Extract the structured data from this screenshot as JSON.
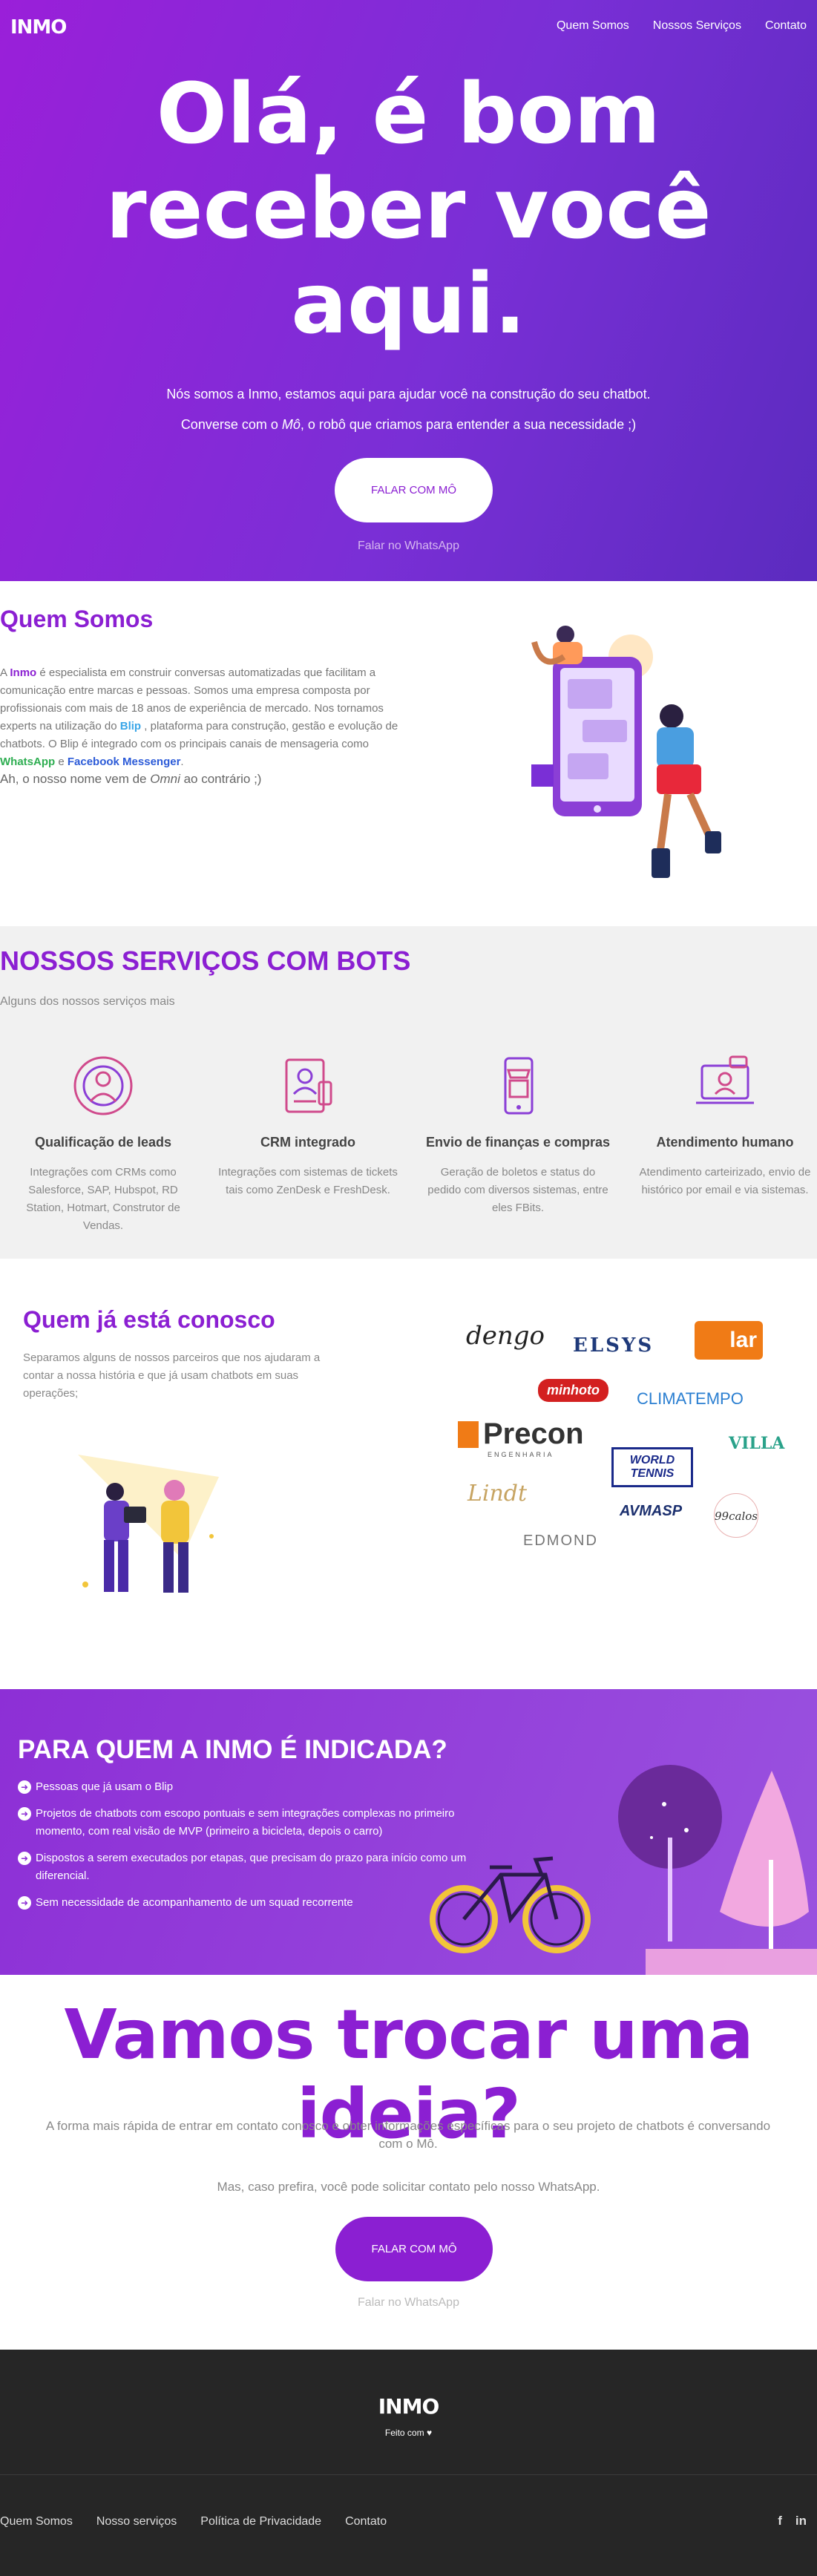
{
  "nav": {
    "logo": "INMO",
    "links": [
      "Quem Somos",
      "Nossos Serviços",
      "Contato"
    ]
  },
  "hero": {
    "title": "Olá, é bom receber você aqui.",
    "subtitle1": "Nós somos a Inmo, estamos aqui para ajudar você na construção do seu chatbot.",
    "subtitle2_pre": "Converse com o ",
    "subtitle2_em": "Mô",
    "subtitle2_post": ", o robô que criamos para entender a sua necessidade ;)",
    "button": "FALAR COM MÔ",
    "whatsapp": "Falar no WhatsApp"
  },
  "quem_somos": {
    "title": "Quem Somos",
    "p_a": "A ",
    "p_inmo": "Inmo",
    "p_b": " é especialista em construir conversas automatizadas que facilitam a comunicação entre marcas e pessoas. Somos uma empresa composta por profissionais com mais de 18 anos de experiência de mercado. Nos tornamos experts na utilização do ",
    "p_blip": "Blip",
    "p_c": " , plataforma para construção, gestão e evolução de chatbots. O Blip é integrado com os principais canais de mensageria como ",
    "p_wa": "WhatsApp",
    "p_d": " e ",
    "p_fb": "Facebook Messenger",
    "p_e": ".",
    "omni_pre": "Ah, o nosso nome vem de ",
    "omni_em": "Omni",
    "omni_post": " ao contrário ;)"
  },
  "servicos": {
    "title": "NOSSOS SERVIÇOS COM BOTS",
    "subtitle": "Alguns dos nossos serviços mais",
    "items": [
      {
        "icon": "user-target-icon",
        "title": "Qualificação de leads",
        "text": "Integrações com CRMs como Salesforce, SAP, Hubspot, RD Station, Hotmart, Construtor de Vendas."
      },
      {
        "icon": "crm-profile-icon",
        "title": "CRM integrado",
        "text": "Integrações com sistemas de tickets tais como ZenDesk e FreshDesk."
      },
      {
        "icon": "store-phone-icon",
        "title": "Envio de finanças e compras",
        "text": "Geração de boletos e status do pedido com diversos sistemas, entre eles FBits."
      },
      {
        "icon": "laptop-chat-icon",
        "title": "Atendimento humano",
        "text": "Atendimento carteirizado, envio de histórico por email e via sistemas."
      }
    ]
  },
  "parceiros": {
    "title": "Quem já está conosco",
    "text": "Separamos alguns de nossos parceiros que nos ajudaram a contar a nossa história e que já usam chatbots em suas operações;",
    "logos": [
      "dengo",
      "ELSYS",
      "lar",
      "minhoto",
      "CLIMATEMPO",
      "Precon",
      "ENGENHARIA",
      "WORLD TENNIS",
      "VILLA",
      "Lindt",
      "AVMASP",
      "99calos",
      "EDMOND"
    ],
    "colors": {
      "dengo": "#222222",
      "elsys": "#1f3a7a",
      "lar": "#f07b16",
      "minhoto": "#d32020",
      "climatempo": "#2b7fd1",
      "precon": "#333333",
      "tennis": "#1a2a8a",
      "villa": "#2aa28a",
      "lindt": "#c7a462",
      "avmasp": "#1b2f6e",
      "edmond": "#777777",
      "calos": "#333333"
    }
  },
  "indicada": {
    "title": "PARA QUEM A INMO É INDICADA?",
    "items": [
      "Pessoas que já usam o Blip",
      "Projetos de chatbots com escopo pontuais e sem integrações complexas no primeiro momento, com real visão de MVP (primeiro a bicicleta, depois o carro)",
      "Dispostos a serem executados por etapas, que precisam do prazo para início como um diferencial.",
      "Sem necessidade de acompanhamento de um squad recorrente"
    ]
  },
  "contato": {
    "title": "Vamos trocar uma ideia?",
    "text1": "A forma mais rápida de entrar em contato conosco e obter informações específicas para o seu projeto de chatbots é conversando com o Mô.",
    "text2": "Mas, caso prefira, você pode solicitar contato pelo nosso WhatsApp.",
    "button": "FALAR COM MÔ",
    "whatsapp": "Falar no WhatsApp"
  },
  "footer": {
    "logo": "INMO",
    "made_with": "Feito com ♥",
    "links": [
      "Quem Somos",
      "Nosso serviços",
      "Política de Privacidade",
      "Contato"
    ],
    "social": [
      "f",
      "in"
    ]
  },
  "colors": {
    "brand": "#8b1fd2",
    "hero_gradient_start": "#9a1fd9",
    "hero_gradient_end": "#5b2bbf",
    "footer": "#262626"
  }
}
